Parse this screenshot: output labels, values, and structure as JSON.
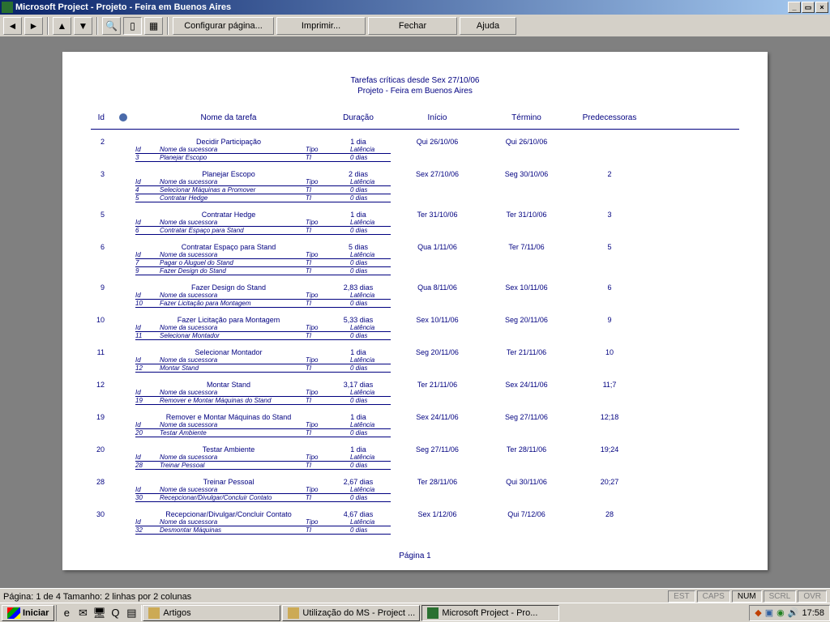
{
  "window": {
    "title": "Microsoft Project - Projeto - Feira em Buenos Aires"
  },
  "toolbar": {
    "page_setup": "Configurar página...",
    "print": "Imprimir...",
    "close": "Fechar",
    "help": "Ajuda"
  },
  "report": {
    "title": "Tarefas críticas desde Sex 27/10/06",
    "subtitle": "Projeto - Feira em Buenos Aires",
    "columns": {
      "id": "Id",
      "name": "Nome da tarefa",
      "duration": "Duração",
      "start": "Início",
      "end": "Término",
      "pred": "Predecessoras"
    },
    "sub_columns": {
      "id": "Id",
      "name": "Nome da sucessora",
      "tipo": "Tipo",
      "lat": "Latência"
    },
    "tasks": [
      {
        "id": "2",
        "name": "Decidir Participação",
        "dur": "1 dia",
        "start": "Qui 26/10/06",
        "end": "Qui 26/10/06",
        "pred": "",
        "subs": [
          {
            "id": "3",
            "name": "Planejar Escopo",
            "tipo": "TI",
            "lat": "0 dias"
          }
        ]
      },
      {
        "id": "3",
        "name": "Planejar Escopo",
        "dur": "2 dias",
        "start": "Sex 27/10/06",
        "end": "Seg 30/10/06",
        "pred": "2",
        "subs": [
          {
            "id": "4",
            "name": "Selecionar Máquinas a Promover",
            "tipo": "TI",
            "lat": "0 dias"
          },
          {
            "id": "5",
            "name": "Contratar Hedge",
            "tipo": "TI",
            "lat": "0 dias"
          }
        ]
      },
      {
        "id": "5",
        "name": "Contratar Hedge",
        "dur": "1 dia",
        "start": "Ter 31/10/06",
        "end": "Ter 31/10/06",
        "pred": "3",
        "subs": [
          {
            "id": "6",
            "name": "Contratar Espaço para Stand",
            "tipo": "TI",
            "lat": "0 dias"
          }
        ]
      },
      {
        "id": "6",
        "name": "Contratar Espaço para Stand",
        "dur": "5 dias",
        "start": "Qua 1/11/06",
        "end": "Ter 7/11/06",
        "pred": "5",
        "subs": [
          {
            "id": "7",
            "name": "Pagar o Aluguel do Stand",
            "tipo": "TI",
            "lat": "0 dias"
          },
          {
            "id": "9",
            "name": "Fazer Design do Stand",
            "tipo": "TI",
            "lat": "0 dias"
          }
        ]
      },
      {
        "id": "9",
        "name": "Fazer Design do Stand",
        "dur": "2,83 dias",
        "start": "Qua 8/11/06",
        "end": "Sex 10/11/06",
        "pred": "6",
        "subs": [
          {
            "id": "10",
            "name": "Fazer Licitação para Montagem",
            "tipo": "TI",
            "lat": "0 dias"
          }
        ]
      },
      {
        "id": "10",
        "name": "Fazer Licitação para Montagem",
        "dur": "5,33 dias",
        "start": "Sex 10/11/06",
        "end": "Seg 20/11/06",
        "pred": "9",
        "subs": [
          {
            "id": "11",
            "name": "Selecionar Montador",
            "tipo": "TI",
            "lat": "0 dias"
          }
        ]
      },
      {
        "id": "11",
        "name": "Selecionar Montador",
        "dur": "1 dia",
        "start": "Seg 20/11/06",
        "end": "Ter 21/11/06",
        "pred": "10",
        "subs": [
          {
            "id": "12",
            "name": "Montar Stand",
            "tipo": "TI",
            "lat": "0 dias"
          }
        ]
      },
      {
        "id": "12",
        "name": "Montar Stand",
        "dur": "3,17 dias",
        "start": "Ter 21/11/06",
        "end": "Sex 24/11/06",
        "pred": "11;7",
        "subs": [
          {
            "id": "19",
            "name": "Remover e Montar Máquinas do Stand",
            "tipo": "TI",
            "lat": "0 dias"
          }
        ]
      },
      {
        "id": "19",
        "name": "Remover e Montar Máquinas do Stand",
        "dur": "1 dia",
        "start": "Sex 24/11/06",
        "end": "Seg 27/11/06",
        "pred": "12;18",
        "subs": [
          {
            "id": "20",
            "name": "Testar Ambiente",
            "tipo": "TI",
            "lat": "0 dias"
          }
        ]
      },
      {
        "id": "20",
        "name": "Testar Ambiente",
        "dur": "1 dia",
        "start": "Seg 27/11/06",
        "end": "Ter 28/11/06",
        "pred": "19;24",
        "subs": [
          {
            "id": "28",
            "name": "Treinar Pessoal",
            "tipo": "TI",
            "lat": "0 dias"
          }
        ]
      },
      {
        "id": "28",
        "name": "Treinar Pessoal",
        "dur": "2,67 dias",
        "start": "Ter 28/11/06",
        "end": "Qui 30/11/06",
        "pred": "20;27",
        "subs": [
          {
            "id": "30",
            "name": "Recepcionar/Divulgar/Concluir Contato",
            "tipo": "TI",
            "lat": "0 dias"
          }
        ]
      },
      {
        "id": "30",
        "name": "Recepcionar/Divulgar/Concluir Contato",
        "dur": "4,67 dias",
        "start": "Sex 1/12/06",
        "end": "Qui 7/12/06",
        "pred": "28",
        "subs": [
          {
            "id": "32",
            "name": "Desmontar Máquinas",
            "tipo": "TI",
            "lat": "0 dias"
          }
        ]
      }
    ],
    "page_label": "Página 1"
  },
  "statusbar": {
    "left": "Página: 1 de 4   Tamanho: 2 linhas por 2 colunas",
    "est": "EST",
    "caps": "CAPS",
    "num": "NUM",
    "scrl": "SCRL",
    "ovr": "OVR"
  },
  "taskbar": {
    "start": "Iniciar",
    "items": [
      {
        "label": "Artigos",
        "active": false
      },
      {
        "label": "Utilização do MS - Project ...",
        "active": false
      },
      {
        "label": "Microsoft Project - Pro...",
        "active": true
      }
    ],
    "time": "17:58"
  }
}
